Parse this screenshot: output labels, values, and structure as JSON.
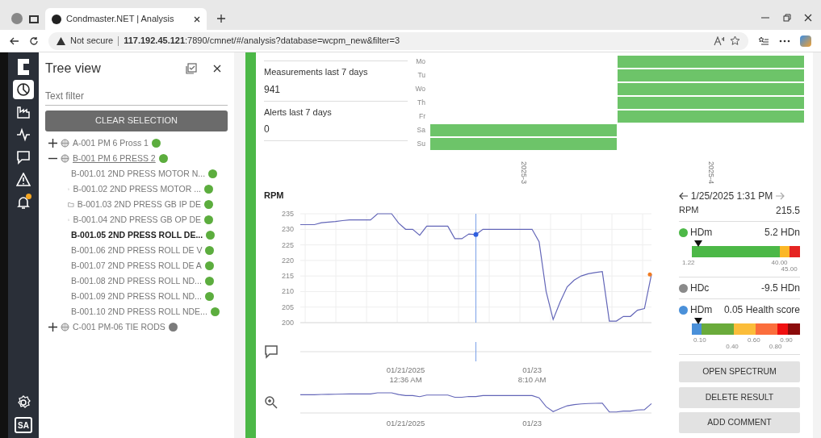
{
  "browser": {
    "tab_title": "Condmaster.NET | Analysis",
    "security": "Not secure",
    "url_host": "117.192.45.121",
    "url_rest": ":7890/cmnet/#/analysis?database=wcpm_new&filter=3"
  },
  "rail": {
    "items": [
      {
        "kind": "analysis",
        "selected": true
      },
      {
        "kind": "factory",
        "selected": false
      },
      {
        "kind": "pulse",
        "selected": false
      },
      {
        "kind": "chat",
        "selected": false
      },
      {
        "kind": "warning",
        "selected": false
      },
      {
        "kind": "bell",
        "selected": false,
        "notified": true
      }
    ],
    "user": "SA"
  },
  "tree": {
    "title": "Tree view",
    "filter_placeholder": "Text filter",
    "clear_button": "CLEAR SELECTION",
    "nodes": [
      {
        "label": "A-001 PM 6 Pross 1",
        "color": "#5cad3e",
        "expanded": false,
        "selected": false
      },
      {
        "label": "B-001 PM 6 PRESS 2",
        "color": "#5cad3e",
        "expanded": true,
        "selected": false,
        "children": [
          {
            "label": "B-001.01 2ND PRESS MOTOR N...",
            "color": "#5cad3e",
            "selected": false
          },
          {
            "label": "B-001.02 2ND PRESS MOTOR ...",
            "color": "#5cad3e",
            "selected": false
          },
          {
            "label": "B-001.03 2ND PRESS GB IP DE",
            "color": "#5cad3e",
            "selected": false
          },
          {
            "label": "B-001.04 2ND PRESS GB OP DE",
            "color": "#5cad3e",
            "selected": false
          },
          {
            "label": "B-001.05 2ND PRESS ROLL DE...",
            "color": "#5cad3e",
            "selected": true
          },
          {
            "label": "B-001.06 2ND PRESS ROLL DE V",
            "color": "#5cad3e",
            "selected": false
          },
          {
            "label": "B-001.07 2ND PRESS ROLL DE A",
            "color": "#5cad3e",
            "selected": false
          },
          {
            "label": "B-001.08 2ND PRESS ROLL ND...",
            "color": "#5cad3e",
            "selected": false
          },
          {
            "label": "B-001.09 2ND PRESS ROLL ND...",
            "color": "#5cad3e",
            "selected": false
          },
          {
            "label": "B-001.10 2ND PRESS ROLL NDE...",
            "color": "#5cad3e",
            "selected": false
          }
        ]
      },
      {
        "label": "C-001 PM-06 TIE RODS",
        "color": "#7b7b7b",
        "expanded": false,
        "selected": false
      }
    ]
  },
  "stats": [
    {
      "label": "Measurements last 7 days",
      "value": "941"
    },
    {
      "label": "Alerts last 7 days",
      "value": "0"
    }
  ],
  "activity": {
    "days": [
      "Mo",
      "Tu",
      "Wo",
      "Th",
      "Fr",
      "Sa",
      "Su"
    ],
    "weeks": [
      {
        "label": "2025-3",
        "filled": [
          false,
          false,
          false,
          false,
          false,
          true,
          true
        ]
      },
      {
        "label": "2025-4",
        "filled": [
          true,
          true,
          true,
          true,
          true,
          false,
          false
        ]
      }
    ]
  },
  "rpm": {
    "time_labels": [
      "12:36 AM",
      "8:10 AM"
    ],
    "chart_data": {
      "type": "line",
      "title": "RPM",
      "grid": true,
      "ylim": [
        200,
        235
      ],
      "yticks": [
        200,
        205,
        210,
        215,
        220,
        225,
        230,
        235
      ],
      "categories": [
        null,
        null,
        null,
        null,
        null,
        null,
        null,
        null,
        null,
        null,
        null,
        null,
        null,
        null,
        null,
        "01/21/2025",
        null,
        null,
        null,
        null,
        null,
        null,
        null,
        null,
        null,
        null,
        null,
        null,
        null,
        null,
        null,
        null,
        null,
        "01/23",
        null,
        null,
        null,
        null,
        null,
        null,
        null,
        null,
        null,
        null,
        null,
        null,
        null,
        null,
        null,
        null,
        null
      ],
      "series": [
        {
          "color": "#6366b8",
          "values": [
            231.5,
            231.5,
            231.5,
            232.1,
            232.3,
            232.5,
            232.8,
            233,
            233,
            233,
            233,
            235,
            235,
            235,
            232,
            230,
            230,
            228.1,
            231,
            231,
            231,
            231,
            227,
            227,
            228.5,
            228.3,
            230,
            230,
            230,
            230,
            230,
            230,
            230,
            230,
            226,
            210,
            201,
            206.7,
            211.5,
            213.7,
            215,
            215.7,
            216.1,
            216.4,
            200.5,
            200.5,
            202,
            202,
            204,
            204.5,
            215.5
          ]
        }
      ]
    }
  },
  "navigator": {
    "x_labels": [
      "01/21/2025",
      "01/23"
    ]
  },
  "detail": {
    "date": "1/25/2025 1:31 PM",
    "rpm_label": "RPM",
    "rpm_value": "215.5",
    "measures": [
      {
        "kind": "gauge",
        "name": "HDm",
        "value": "5.2 HDn",
        "color": "#4cb847",
        "start_label": "1.22",
        "segments": [
          {
            "color": "#4cb847",
            "end_label": "40.00"
          },
          {
            "color": "#fbb726",
            "end_label": "45.00"
          },
          {
            "color": "#e52421"
          }
        ]
      },
      {
        "kind": "plain",
        "name": "HDc",
        "value": "-9.5 HDn",
        "color": "#8a8a8a"
      },
      {
        "kind": "gauge",
        "name": "HDm",
        "value": "0.05 Health score",
        "color": "#4a90d9",
        "segments": [
          {
            "color": "#4a90d9",
            "end_label": "0.10"
          },
          {
            "color": "#6aab3b",
            "end_label": "0.40"
          },
          {
            "color": "#fbbd3a",
            "end_label": "0.60"
          },
          {
            "color": "#fb6e3c",
            "end_label": "0.80"
          },
          {
            "color": "#f01010",
            "end_label": "0.90"
          },
          {
            "color": "#8b0b0b"
          }
        ]
      }
    ],
    "buttons": [
      "OPEN SPECTRUM",
      "DELETE RESULT",
      "ADD COMMENT"
    ]
  }
}
